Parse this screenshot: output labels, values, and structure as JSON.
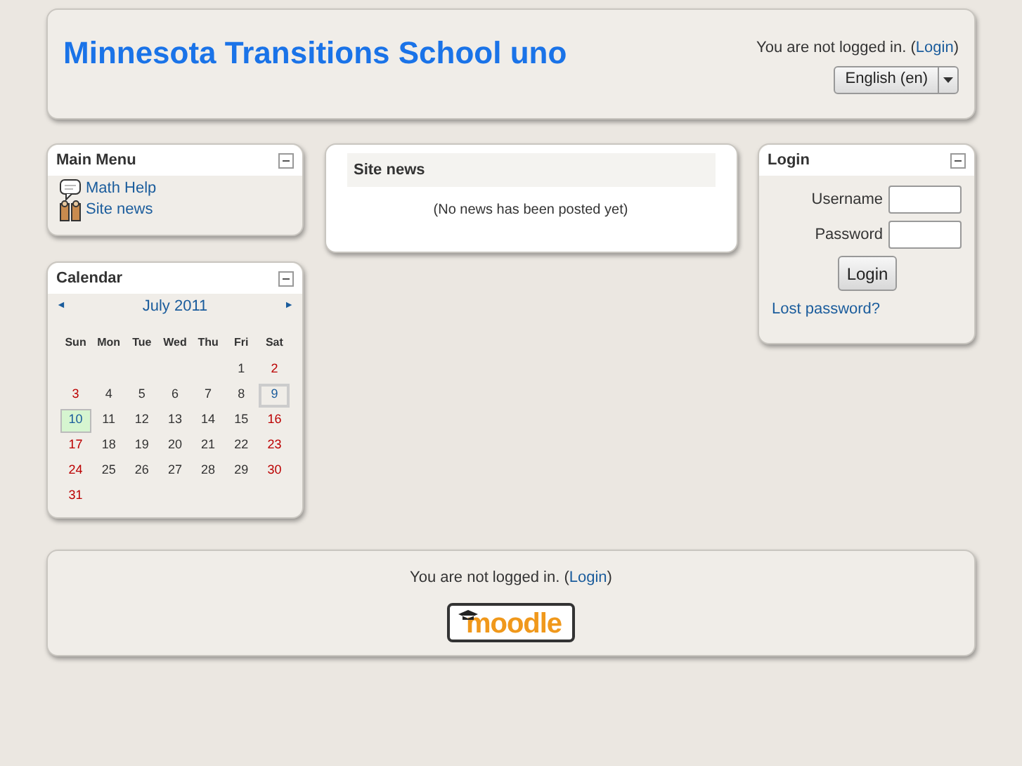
{
  "header": {
    "title": "Minnesota Transitions School uno",
    "login_notice": {
      "before": "You are not logged in. (",
      "link": "Login",
      "after": ")"
    },
    "language": "English (en)"
  },
  "main_menu": {
    "title": "Main Menu",
    "items": [
      {
        "kind": "forum",
        "label": "Math Help"
      },
      {
        "kind": "news",
        "label": "Site news"
      }
    ]
  },
  "calendar": {
    "title": "Calendar",
    "prev": "◄",
    "month": "July 2011",
    "next": "►",
    "weekdays": [
      "Sun",
      "Mon",
      "Tue",
      "Wed",
      "Thu",
      "Fri",
      "Sat"
    ],
    "weeks": [
      {
        "right_aligned": true,
        "days": [
          {
            "day": "1",
            "kind": "weekday"
          },
          {
            "day": "2",
            "kind": "weekend"
          }
        ]
      },
      {
        "right_aligned": false,
        "days": [
          {
            "day": "3",
            "kind": "weekend"
          },
          {
            "day": "4",
            "kind": "weekday"
          },
          {
            "day": "5",
            "kind": "weekday"
          },
          {
            "day": "6",
            "kind": "weekday"
          },
          {
            "day": "7",
            "kind": "weekday"
          },
          {
            "day": "8",
            "kind": "weekday"
          },
          {
            "day": "9",
            "kind": "today"
          }
        ]
      },
      {
        "right_aligned": false,
        "days": [
          {
            "day": "10",
            "kind": "event"
          },
          {
            "day": "11",
            "kind": "weekday"
          },
          {
            "day": "12",
            "kind": "weekday"
          },
          {
            "day": "13",
            "kind": "weekday"
          },
          {
            "day": "14",
            "kind": "weekday"
          },
          {
            "day": "15",
            "kind": "weekday"
          },
          {
            "day": "16",
            "kind": "weekend"
          }
        ]
      },
      {
        "right_aligned": false,
        "days": [
          {
            "day": "17",
            "kind": "weekend"
          },
          {
            "day": "18",
            "kind": "weekday"
          },
          {
            "day": "19",
            "kind": "weekday"
          },
          {
            "day": "20",
            "kind": "weekday"
          },
          {
            "day": "21",
            "kind": "weekday"
          },
          {
            "day": "22",
            "kind": "weekday"
          },
          {
            "day": "23",
            "kind": "weekend"
          }
        ]
      },
      {
        "right_aligned": false,
        "days": [
          {
            "day": "24",
            "kind": "weekend"
          },
          {
            "day": "25",
            "kind": "weekday"
          },
          {
            "day": "26",
            "kind": "weekday"
          },
          {
            "day": "27",
            "kind": "weekday"
          },
          {
            "day": "28",
            "kind": "weekday"
          },
          {
            "day": "29",
            "kind": "weekday"
          },
          {
            "day": "30",
            "kind": "weekend"
          }
        ]
      },
      {
        "right_aligned": false,
        "days": [
          {
            "day": "31",
            "kind": "weekend"
          }
        ]
      }
    ]
  },
  "site_news": {
    "title": "Site news",
    "message": "(No news has been posted yet)"
  },
  "login": {
    "title": "Login",
    "username_label": "Username",
    "password_label": "Password",
    "button": "Login",
    "lost_password": "Lost password?"
  },
  "footer": {
    "login_notice": {
      "before": "You are not logged in. (",
      "link": "Login",
      "after": ")"
    },
    "logo": "moodle"
  }
}
